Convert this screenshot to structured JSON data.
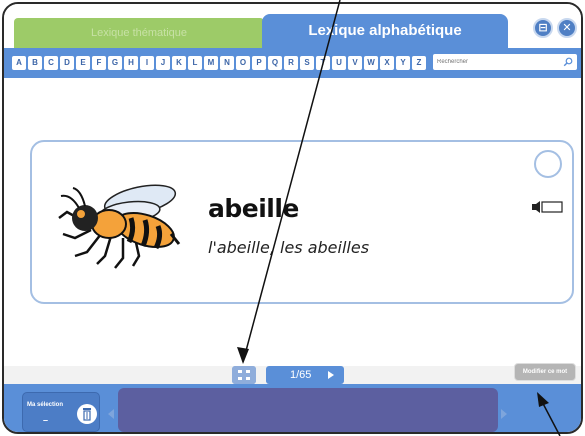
{
  "tabs": {
    "thematic": "Lexique thématique",
    "alphabetic": "Lexique alphabétique"
  },
  "window_buttons": {
    "minimize": "⊟",
    "close": "✕"
  },
  "alphabet": [
    "A",
    "B",
    "C",
    "D",
    "E",
    "F",
    "G",
    "H",
    "I",
    "J",
    "K",
    "L",
    "M",
    "N",
    "O",
    "P",
    "Q",
    "R",
    "S",
    "T",
    "U",
    "V",
    "W",
    "X",
    "Y",
    "Z"
  ],
  "search": {
    "placeholder": "Rechercher"
  },
  "card": {
    "word": "abeille",
    "forms": "l'abeille, les abeilles",
    "icons": [
      "bee-illustration",
      "select-circle",
      "speaker-icon"
    ]
  },
  "pager": {
    "label": "1/65"
  },
  "modify_button": "Modifier ce mot",
  "selection": {
    "label": "Ma sélection",
    "count": "–"
  },
  "icons": [
    "search-icon",
    "grid-icon",
    "next-arrow-icon",
    "trash-icon",
    "prev-arrow-icon",
    "next-arrow-icon"
  ],
  "colors": {
    "tab_green": "#9dcb68",
    "primary_blue": "#5a8fd8",
    "card_border": "#a4bfe3",
    "selection_panel": "#5c5fa0",
    "annotation": "#111111"
  }
}
